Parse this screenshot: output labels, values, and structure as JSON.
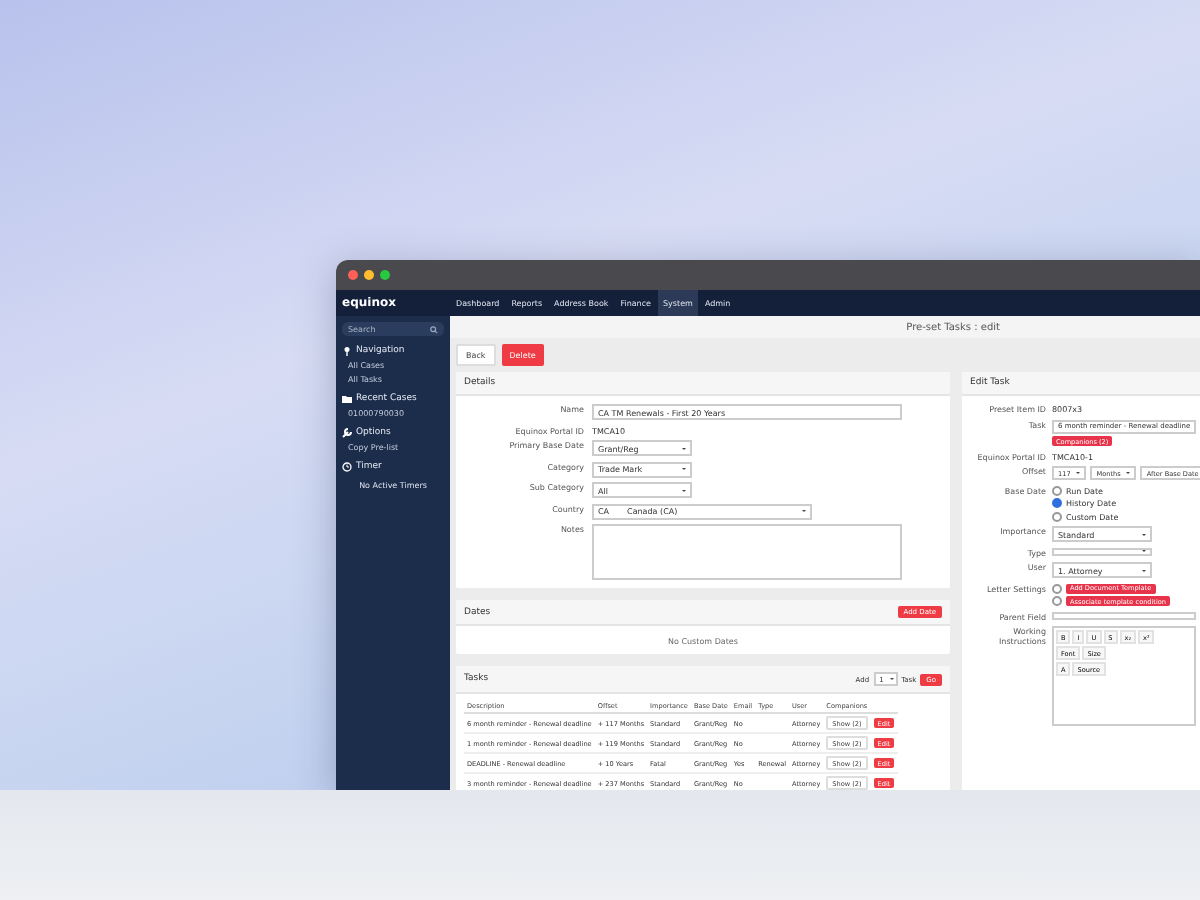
{
  "window": {
    "logo": "equinox"
  },
  "nav": [
    {
      "label": "Dashboard",
      "selected": false
    },
    {
      "label": "Reports",
      "selected": false
    },
    {
      "label": "Address Book",
      "selected": false
    },
    {
      "label": "Finance",
      "selected": false
    },
    {
      "label": "System",
      "selected": true
    },
    {
      "label": "Admin",
      "selected": false
    }
  ],
  "sidebar": {
    "search_placeholder": "Search",
    "sections": [
      {
        "title": "Navigation",
        "items": [
          "All Cases",
          "All Tasks"
        ]
      },
      {
        "title": "Recent Cases",
        "items": [
          "01000790030"
        ]
      },
      {
        "title": "Options",
        "items": [
          "Copy Pre-list"
        ]
      },
      {
        "title": "Timer"
      }
    ],
    "timer_note": "No Active Timers"
  },
  "page_title": "Pre-set Tasks : edit",
  "actions": [
    {
      "label": "Back",
      "kind": "plain"
    },
    {
      "label": "Delete",
      "kind": "danger"
    }
  ],
  "details": {
    "title": "Details",
    "fields": [
      {
        "label": "Name",
        "kind": "text",
        "value": "CA TM Renewals - First 20 Years"
      },
      {
        "label": "Equinox Portal ID",
        "kind": "static",
        "value": "TMCA10"
      },
      {
        "label": "Primary Base Date",
        "kind": "select",
        "value": "Grant/Reg"
      },
      {
        "label": "Category",
        "kind": "select",
        "value": "Trade Mark"
      },
      {
        "label": "Sub Category",
        "kind": "select",
        "value": "All"
      },
      {
        "label": "Country",
        "kind": "country",
        "code": "CA",
        "value": "Canada (CA)"
      },
      {
        "label": "Notes",
        "kind": "textarea"
      }
    ]
  },
  "dates": {
    "title": "Dates",
    "button": "Add Date",
    "empty": "No Custom Dates"
  },
  "tasks": {
    "title": "Tasks",
    "add_label": "Add",
    "add_count": "1",
    "add_unit": "Task",
    "go": "Go",
    "columns": [
      "Description",
      "Offset",
      "Importance",
      "Base Date",
      "Email",
      "Type",
      "User",
      "Companions"
    ],
    "rows": [
      {
        "cells": [
          "6 month reminder - Renewal deadline",
          "+ 117 Months",
          "Standard",
          "Grant/Reg",
          "No",
          "",
          "Attorney"
        ],
        "companions": "Show (2)",
        "edit": "Edit"
      },
      {
        "cells": [
          "1 month reminder - Renewal deadline",
          "+ 119 Months",
          "Standard",
          "Grant/Reg",
          "No",
          "",
          "Attorney"
        ],
        "companions": "Show (2)",
        "edit": "Edit"
      },
      {
        "cells": [
          "DEADLINE - Renewal deadline",
          "+ 10 Years",
          "Fatal",
          "Grant/Reg",
          "Yes",
          "Renewal",
          "Attorney"
        ],
        "companions": "Show (2)",
        "edit": "Edit"
      },
      {
        "cells": [
          "3 month reminder - Renewal deadline",
          "+ 237 Months",
          "Standard",
          "Grant/Reg",
          "No",
          "",
          "Attorney"
        ],
        "companions": "Show (2)",
        "edit": "Edit"
      }
    ]
  },
  "edit_task": {
    "title": "Edit Task",
    "fields": [
      {
        "label": "Preset Item ID",
        "kind": "static",
        "value": "8007x3"
      },
      {
        "label": "Task",
        "kind": "text",
        "value": "6 month reminder - Renewal deadline",
        "badge": "Companions (2)"
      },
      {
        "label": "Equinox Portal ID",
        "kind": "static",
        "value": "TMCA10-1"
      },
      {
        "label": "Offset",
        "kind": "offset",
        "values": [
          "117",
          "Months",
          "After Base Date"
        ]
      },
      {
        "label": "Base Date",
        "kind": "radios",
        "options": [
          {
            "label": "Run Date",
            "selected": false
          },
          {
            "label": "History Date",
            "selected": true
          },
          {
            "label": "Custom Date",
            "selected": false
          }
        ]
      },
      {
        "label": "Importance",
        "kind": "select",
        "value": "Standard"
      },
      {
        "label": "Type",
        "kind": "select"
      },
      {
        "label": "User",
        "kind": "select",
        "value": "1. Attorney"
      },
      {
        "label": "Letter Settings",
        "kind": "badges",
        "options": [
          {
            "label": "Add Document Template",
            "selected": false
          },
          {
            "label": "Associate template condition",
            "selected": false
          }
        ]
      },
      {
        "label": "Parent Field",
        "kind": "text"
      },
      {
        "label": "Working Instructions",
        "kind": "editor",
        "tools": [
          [
            "B",
            "I",
            "U",
            "S",
            "x₂",
            "x²"
          ],
          [
            "Font",
            "Size"
          ],
          [
            "A",
            "Source"
          ]
        ]
      }
    ]
  }
}
